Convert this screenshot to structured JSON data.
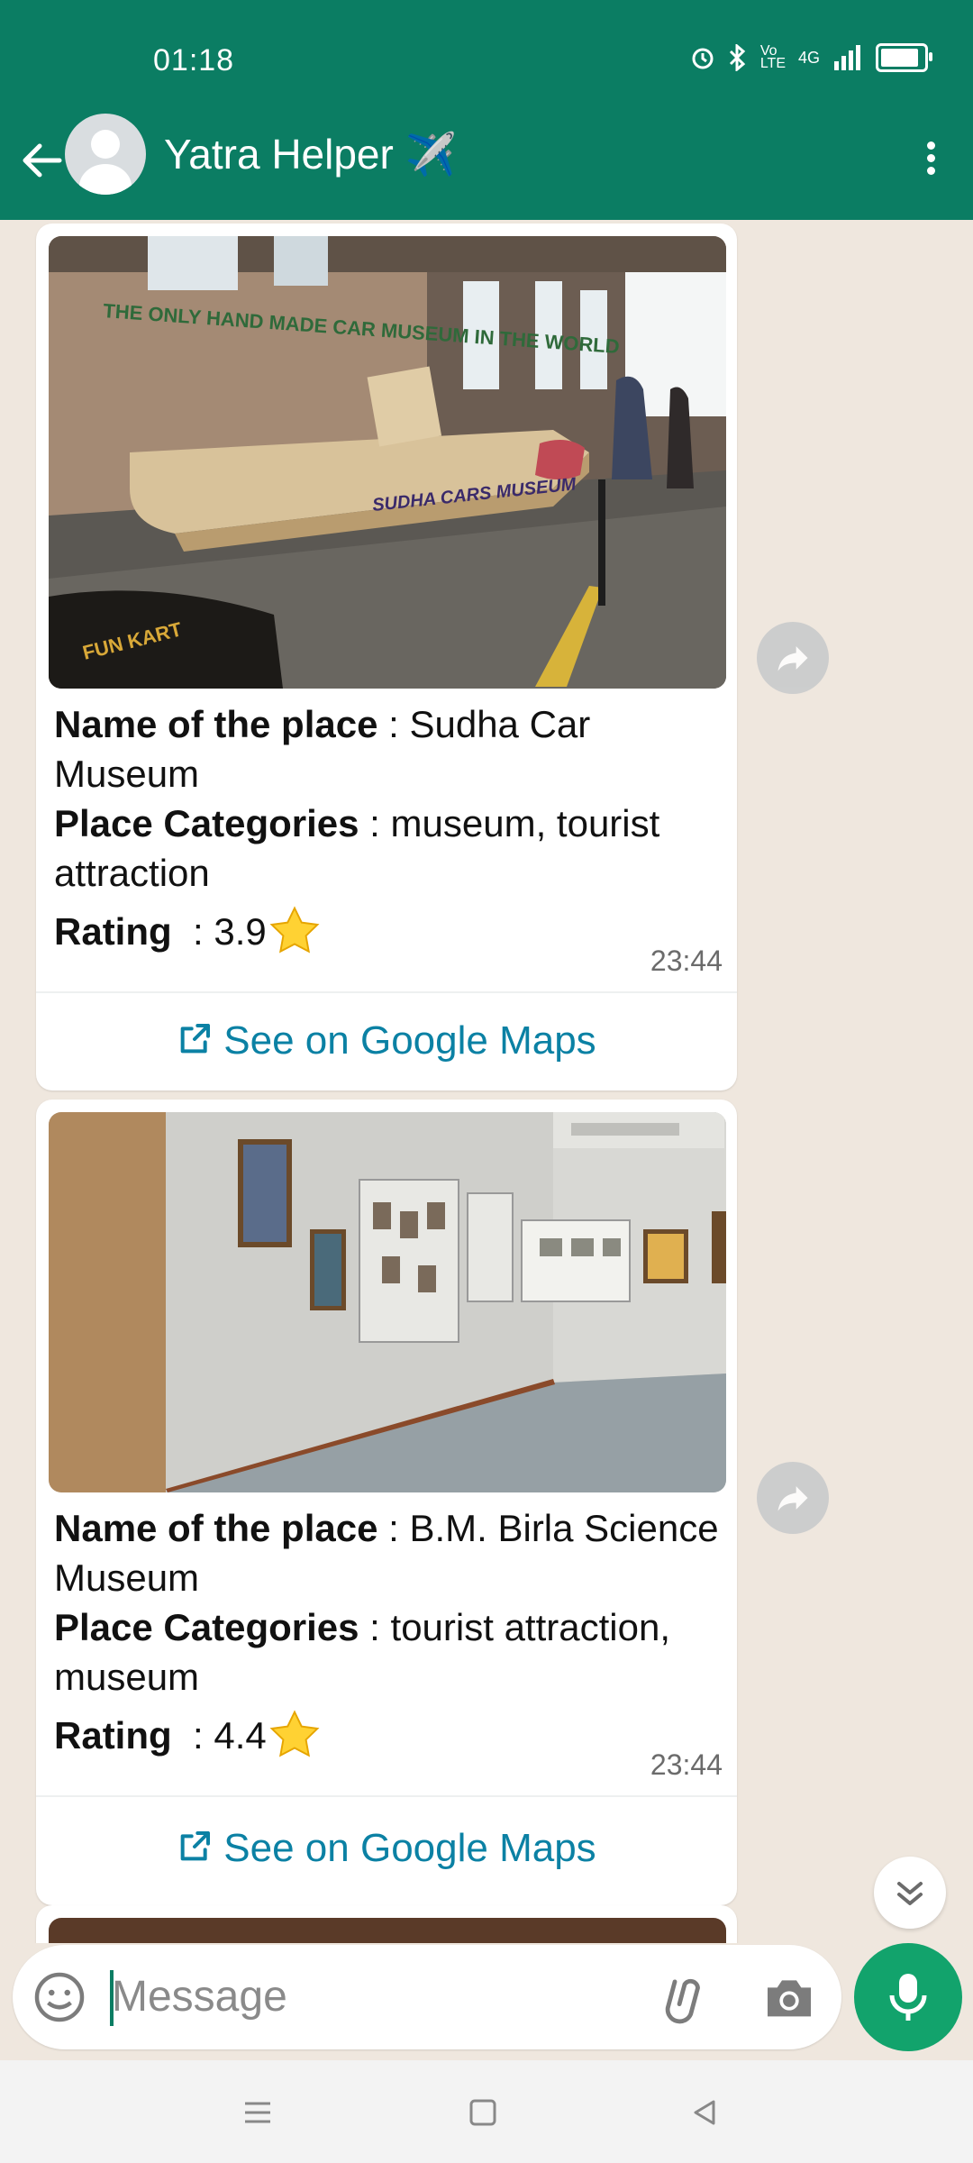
{
  "status_bar": {
    "time": "01:18",
    "signal_label": "4G"
  },
  "header": {
    "title": "Yatra Helper ✈️"
  },
  "messages": [
    {
      "name_label": "Name of the place",
      "name_value": "Sudha Car Museum",
      "categories_label": "Place Categories",
      "categories_value": "museum, tourist attraction",
      "rating_label": "Rating",
      "rating_value": "3.9",
      "rating_icon": "star-emoji",
      "time": "23:44",
      "link_label": "See on Google Maps",
      "image_text": {
        "wall": "THE ONLY HAND MADE CAR MUSEUM IN THE WORLD",
        "car": "SUDHA CARS MUSEUM",
        "sign": "FUN KART"
      }
    },
    {
      "name_label": "Name of the place",
      "name_value": "B.M. Birla Science Museum",
      "categories_label": "Place Categories",
      "categories_value": "tourist attraction, museum",
      "rating_label": "Rating",
      "rating_value": "4.4",
      "rating_icon": "star-emoji",
      "time": "23:44",
      "link_label": "See on Google Maps"
    }
  ],
  "input": {
    "placeholder": "Message"
  },
  "colors": {
    "header": "#0b7d63",
    "link": "#0b81a4",
    "chat_bg": "#efe7de",
    "mic": "#12a36c"
  }
}
